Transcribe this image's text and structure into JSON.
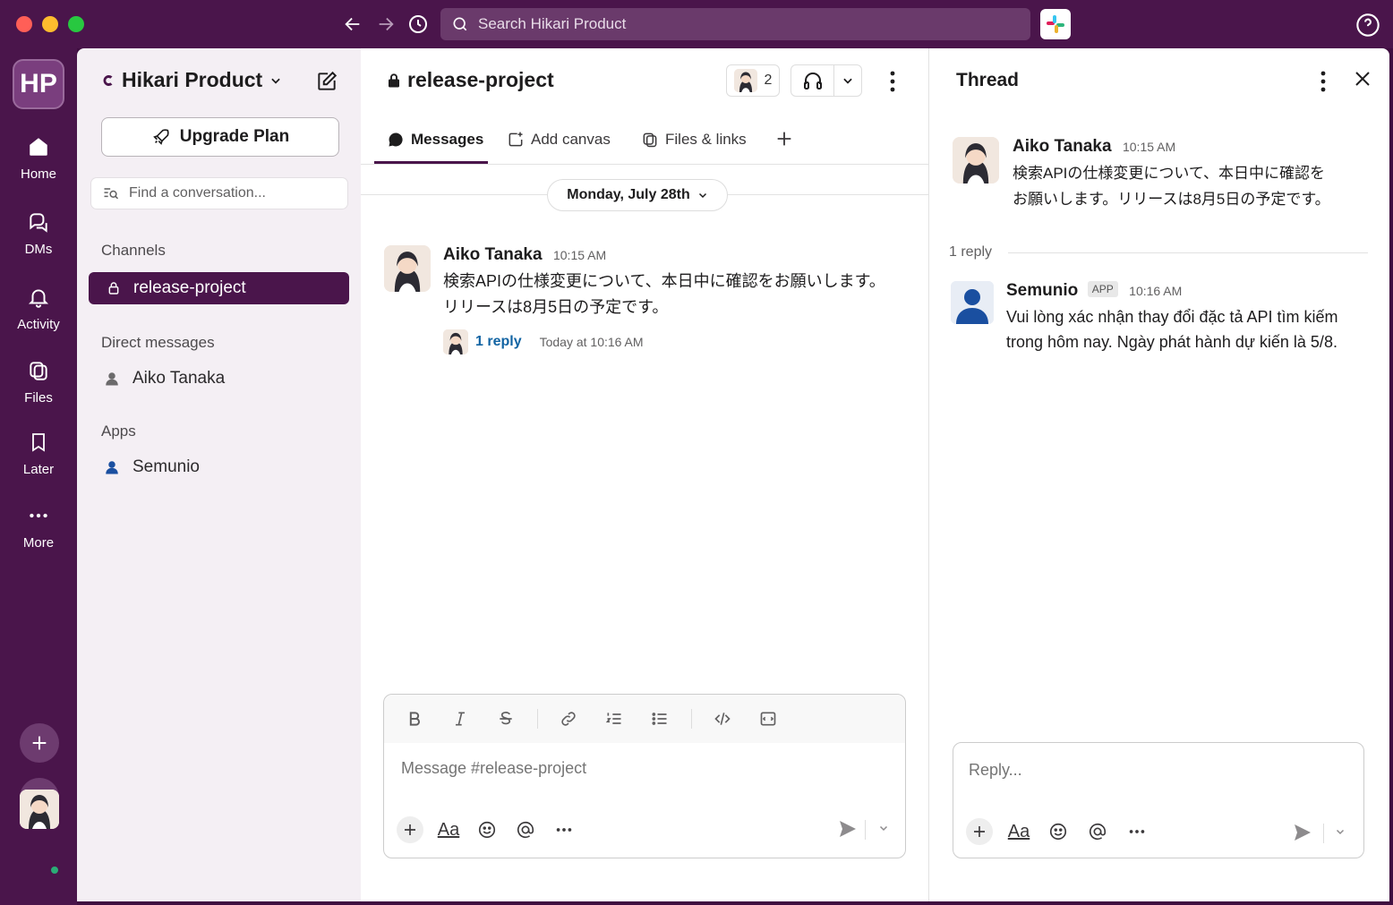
{
  "window": {
    "search_placeholder": "Search Hikari Product"
  },
  "rail": {
    "workspace_initials": "HP",
    "items": [
      {
        "label": "Home"
      },
      {
        "label": "DMs"
      },
      {
        "label": "Activity"
      },
      {
        "label": "Files"
      },
      {
        "label": "Later"
      },
      {
        "label": "More"
      }
    ]
  },
  "sidebar": {
    "workspace_name": "Hikari Product",
    "upgrade_label": "Upgrade Plan",
    "find_placeholder": "Find a conversation...",
    "channels_header": "Channels",
    "channels": [
      {
        "name": "release-project"
      }
    ],
    "dm_header": "Direct messages",
    "dms": [
      {
        "name": "Aiko Tanaka"
      }
    ],
    "apps_header": "Apps",
    "apps": [
      {
        "name": "Semunio"
      }
    ]
  },
  "channel": {
    "name": "release-project",
    "member_count": "2",
    "tabs": [
      {
        "label": "Messages"
      },
      {
        "label": "Add canvas"
      },
      {
        "label": "Files & links"
      }
    ],
    "date_divider": "Monday, July 28th",
    "messages": [
      {
        "author": "Aiko Tanaka",
        "time": "10:15 AM",
        "text_line1": "検索APIの仕様変更について、本日中に確認をお願いします。",
        "text_line2": "リリースは8月5日の予定です。",
        "reply_count_label": "1 reply",
        "last_reply": "Today at 10:16 AM"
      }
    ],
    "composer_placeholder": "Message #release-project"
  },
  "thread": {
    "title": "Thread",
    "parent": {
      "author": "Aiko Tanaka",
      "time": "10:15 AM",
      "text_line1": "検索APIの仕様変更について、本日中に確認を",
      "text_line2": "お願いします。リリースは8月5日の予定です。"
    },
    "replies_label": "1 reply",
    "replies": [
      {
        "author": "Semunio",
        "tag": "APP",
        "time": "10:16 AM",
        "text_line1": "Vui lòng xác nhận thay đổi đặc tả API tìm kiếm",
        "text_line2": "trong hôm nay. Ngày phát hành dự kiến là 5/8."
      }
    ],
    "composer_placeholder": "Reply..."
  },
  "colors": {
    "aubergine": "#4a154b",
    "link": "#1264a3",
    "online": "#2bac76"
  }
}
